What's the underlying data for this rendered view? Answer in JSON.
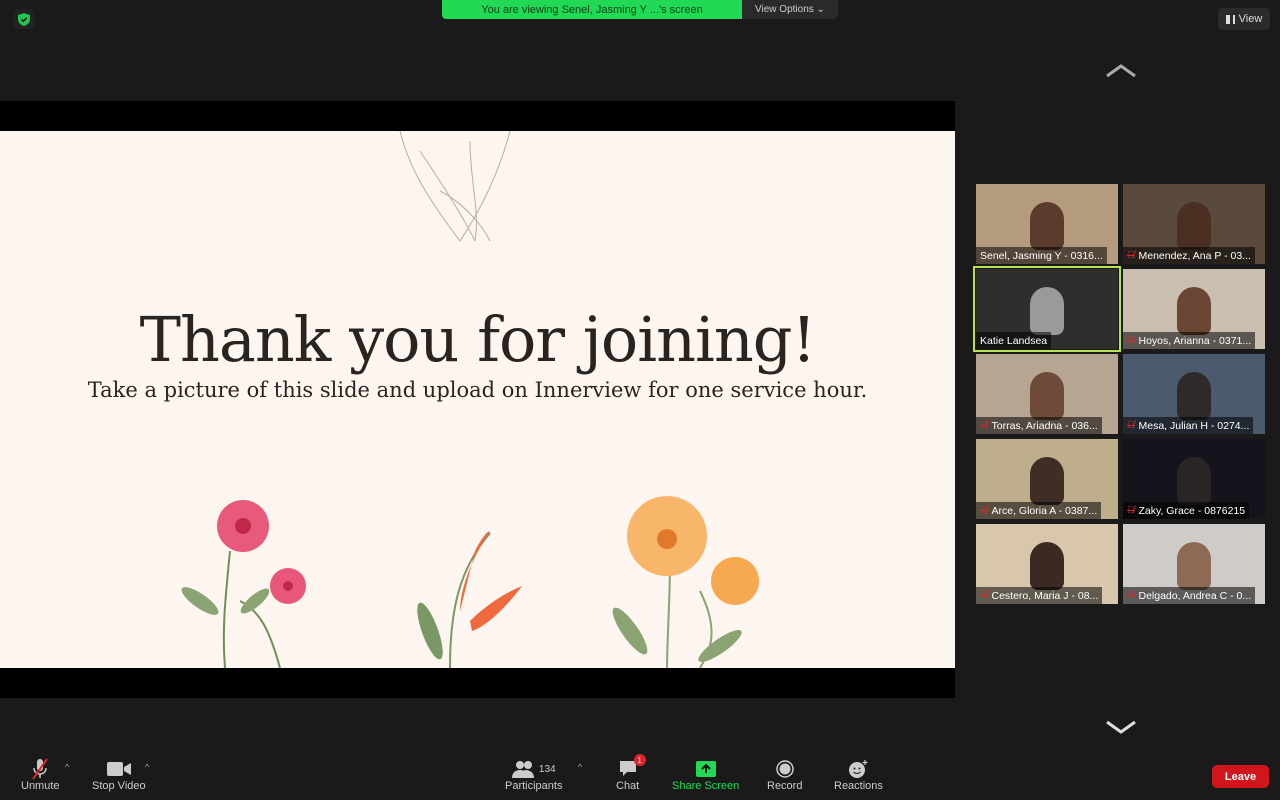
{
  "banner": {
    "text": "You are viewing Senel, Jasming Y ...'s screen",
    "view_options": "View Options"
  },
  "view_button": "View",
  "slide": {
    "title": "Thank you for joining!",
    "subtitle": "Take a picture of this slide and upload on Innerview for one service hour."
  },
  "participants": [
    {
      "name": "Senel, Jasming Y - 0316...",
      "muted": false,
      "bg": "#b69c7e",
      "face": "#5a3b2c"
    },
    {
      "name": "Menendez, Ana P - 03...",
      "muted": true,
      "bg": "#5a4a3c",
      "face": "#4a2f22"
    },
    {
      "name": "Katie Landsea",
      "muted": false,
      "active": true,
      "bg": "#2e2e2e",
      "face": "#9a9a9a"
    },
    {
      "name": "Hoyos, Arianna - 0371...",
      "muted": true,
      "bg": "#c9beb0",
      "face": "#6b4634"
    },
    {
      "name": "Torras, Ariadna - 036...",
      "muted": true,
      "bg": "#b7a593",
      "face": "#6d4b38"
    },
    {
      "name": "Mesa, Julian H - 0274...",
      "muted": true,
      "bg": "#4c5a6d",
      "face": "#2e2a2a"
    },
    {
      "name": "Arce, Gloria A - 0387...",
      "muted": true,
      "bg": "#bfae8c",
      "face": "#3f2e26"
    },
    {
      "name": "Zaky, Grace - 0876215",
      "muted": true,
      "bg": "#15141c",
      "face": "#2a2628"
    },
    {
      "name": "Cestero, Maria J - 08...",
      "muted": true,
      "bg": "#d8c7ad",
      "face": "#3a2a22"
    },
    {
      "name": "Delgado, Andrea C - 0...",
      "muted": true,
      "bg": "#cfcbc8",
      "face": "#8c6a55"
    }
  ],
  "toolbar": {
    "unmute": "Unmute",
    "stop_video": "Stop Video",
    "participants": "Participants",
    "participant_count": "134",
    "chat": "Chat",
    "chat_badge": "1",
    "share_screen": "Share Screen",
    "record": "Record",
    "reactions": "Reactions",
    "leave": "Leave"
  },
  "colors": {
    "share_green": "#21d954",
    "leave_red": "#d0161c",
    "active_speaker": "#b6e352"
  }
}
